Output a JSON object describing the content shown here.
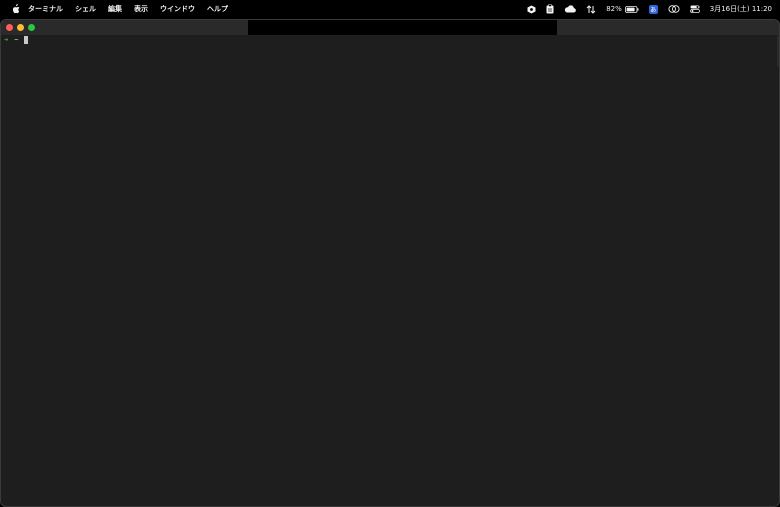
{
  "menubar": {
    "app_name": "ターミナル",
    "items": [
      "シェル",
      "編集",
      "表示",
      "ウインドウ",
      "ヘルプ"
    ],
    "battery_percent": "82%",
    "ime_indicator": "あ",
    "datetime": "3月16日(土) 11:20"
  },
  "window": {
    "traffic_lights": {
      "close": "#ff5f57",
      "minimize": "#febc2e",
      "zoom": "#28c840"
    }
  },
  "terminal": {
    "prompt_arrow": "➜",
    "cwd": "~"
  }
}
